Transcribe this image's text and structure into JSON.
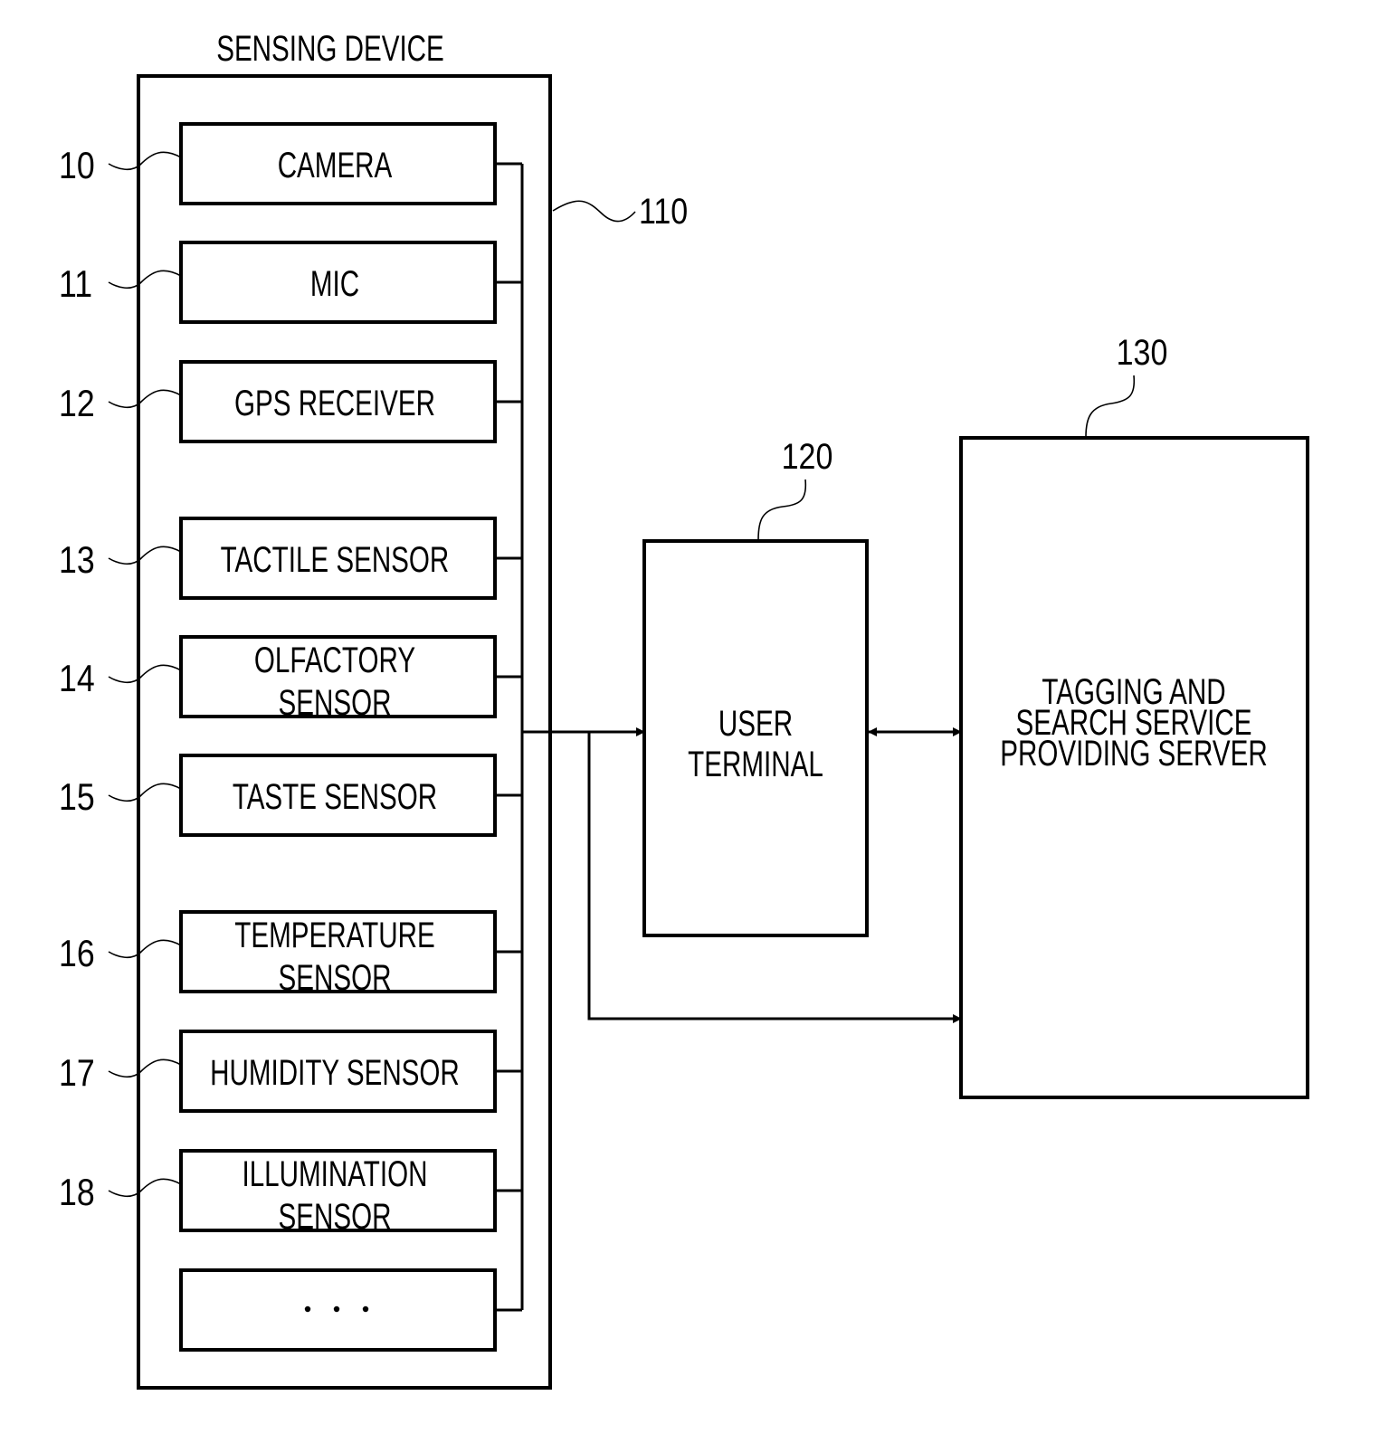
{
  "figure": {
    "sensing_device": {
      "title": "SENSING DEVICE",
      "ref": "110",
      "sensors": [
        {
          "ref": "10",
          "lines": [
            "CAMERA"
          ]
        },
        {
          "ref": "11",
          "lines": [
            "MIC"
          ]
        },
        {
          "ref": "12",
          "lines": [
            "GPS RECEIVER"
          ]
        },
        {
          "ref": "13",
          "lines": [
            "TACTILE SENSOR"
          ]
        },
        {
          "ref": "14",
          "lines": [
            "OLFACTORY",
            "SENSOR"
          ]
        },
        {
          "ref": "15",
          "lines": [
            "TASTE SENSOR"
          ]
        },
        {
          "ref": "16",
          "lines": [
            "TEMPERATURE",
            "SENSOR"
          ]
        },
        {
          "ref": "17",
          "lines": [
            "HUMIDITY SENSOR"
          ]
        },
        {
          "ref": "18",
          "lines": [
            "ILLUMINATION",
            "SENSOR"
          ]
        },
        {
          "ref": "",
          "lines": [
            "ellipsis"
          ]
        }
      ]
    },
    "user_terminal": {
      "ref": "120",
      "lines": [
        "USER",
        "TERMINAL"
      ]
    },
    "server": {
      "ref": "130",
      "lines": [
        "TAGGING AND",
        "SEARCH SERVICE",
        "PROVIDING SERVER"
      ]
    },
    "connections": [
      {
        "from": "sensing_device",
        "to": "user_terminal",
        "type": "arrow"
      },
      {
        "from": "sensing_device",
        "to": "server",
        "type": "arrow"
      },
      {
        "from": "user_terminal",
        "to": "server",
        "type": "bidirectional-arrow"
      }
    ],
    "colors": {
      "ink": "#000000",
      "background": "#ffffff"
    }
  }
}
